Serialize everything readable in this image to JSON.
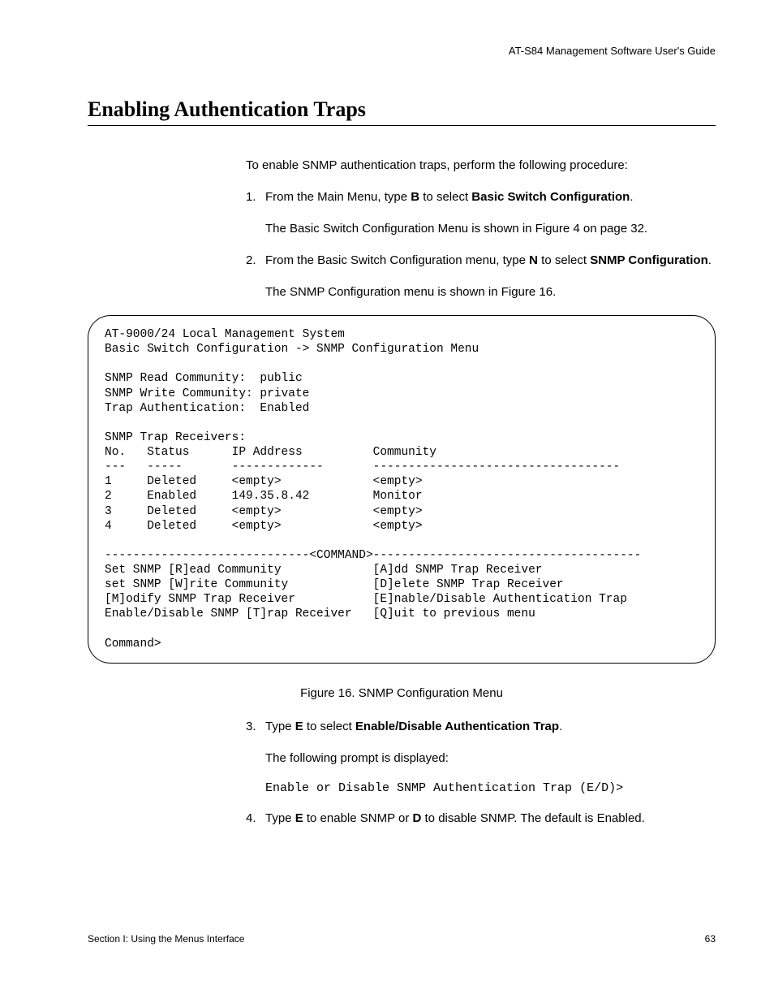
{
  "header": {
    "guide_title": "AT-S84 Management Software User's Guide"
  },
  "section": {
    "title": "Enabling Authentication Traps"
  },
  "intro": "To enable SNMP authentication traps, perform the following procedure:",
  "steps": {
    "s1": {
      "num": "1.",
      "pre": "From the Main Menu, type ",
      "key": "B",
      "mid": " to select ",
      "target": "Basic Switch Configuration",
      "post": ".",
      "follow": "The Basic Switch Configuration Menu is shown in Figure 4 on page 32."
    },
    "s2": {
      "num": "2.",
      "pre": "From the Basic Switch Configuration menu, type ",
      "key": "N",
      "mid": " to select ",
      "target": "SNMP Configuration",
      "post": ".",
      "follow": "The SNMP Configuration menu is shown in Figure 16."
    },
    "s3": {
      "num": "3.",
      "pre": "Type ",
      "key": "E",
      "mid": " to select ",
      "target": "Enable/Disable Authentication Trap",
      "post": ".",
      "follow": "The following prompt is displayed:",
      "prompt": "Enable or Disable SNMP Authentication Trap (E/D)>"
    },
    "s4": {
      "num": "4.",
      "pre": "Type ",
      "key1": "E",
      "mid1": " to enable SNMP or ",
      "key2": "D",
      "mid2": " to disable SNMP. The default is Enabled."
    }
  },
  "terminal": "AT-9000/24 Local Management System\nBasic Switch Configuration -> SNMP Configuration Menu\n\nSNMP Read Community:  public\nSNMP Write Community: private\nTrap Authentication:  Enabled\n\nSNMP Trap Receivers:\nNo.   Status      IP Address          Community\n---   -----       -------------       -----------------------------------\n1     Deleted     <empty>             <empty>\n2     Enabled     149.35.8.42         Monitor\n3     Deleted     <empty>             <empty>\n4     Deleted     <empty>             <empty>\n\n-----------------------------<COMMAND>--------------------------------------\nSet SNMP [R]ead Community             [A]dd SNMP Trap Receiver\nset SNMP [W]rite Community            [D]elete SNMP Trap Receiver\n[M]odify SNMP Trap Receiver           [E]nable/Disable Authentication Trap\nEnable/Disable SNMP [T]rap Receiver   [Q]uit to previous menu\n\nCommand>",
  "figure_caption": "Figure 16. SNMP Configuration Menu",
  "footer": {
    "section_label": "Section I: Using the Menus Interface",
    "page_number": "63"
  }
}
